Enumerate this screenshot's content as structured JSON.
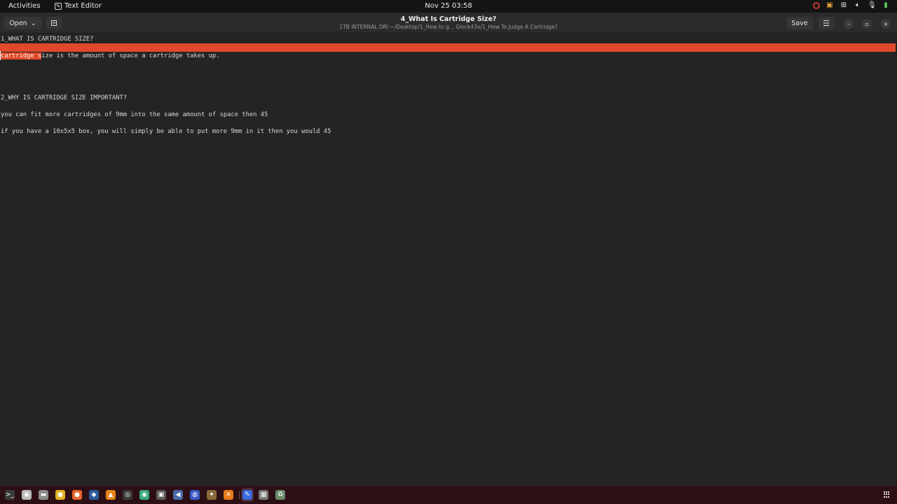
{
  "topbar": {
    "activities": "Activities",
    "app_name": "Text Editor",
    "clock": "Nov 25  03:58",
    "tray_icons": [
      "record-disc-icon",
      "screen-share-icon",
      "network-icon",
      "volume-icon",
      "microphone-icon",
      "battery-icon"
    ]
  },
  "headerbar": {
    "open_label": "Open",
    "open_chevron": "⌄",
    "new_tab_icon": "+",
    "title": "4_What Is Cartridge Size?",
    "subtitle": "1TB INTERNAL DRI ~/Desktop/1_How to g… Glock43x/1_How To Judge A Cartridge?",
    "save_label": "Save",
    "menu_icon": "☰",
    "minimize_icon": "–",
    "maximize_icon": "▫",
    "close_icon": "×"
  },
  "editor": {
    "lines": [
      "1_WHAT IS CARTRIDGE SIZE?",
      "",
      "cartridge size is the amount of space a cartridge takes up.",
      "",
      "",
      "2_WHY IS CARTRIDGE SIZE IMPORTANT?",
      "",
      "you can fit more cartridges of 9mm into the same amount of space then 45",
      "",
      "if you have a 10x5x5 box, you will simply be able to put more 9mm in it then you would 45"
    ],
    "line3_selected": "cartridge s",
    "line3_rest": "ize is the amount of space a cartridge takes up.",
    "highlight_color": "#e0492a"
  },
  "dock": {
    "apps": [
      {
        "name": "terminal",
        "glyph": ">_",
        "color": "#3a3a3a"
      },
      {
        "name": "screenshot",
        "glyph": "◉",
        "color": "#bdbdbd"
      },
      {
        "name": "files",
        "glyph": "▬",
        "color": "#8a8a8a"
      },
      {
        "name": "chrome",
        "glyph": "●",
        "color": "#e0b020"
      },
      {
        "name": "firefox",
        "glyph": "●",
        "color": "#e8632a"
      },
      {
        "name": "steam",
        "glyph": "◆",
        "color": "#2a5a9a"
      },
      {
        "name": "vlc",
        "glyph": "▲",
        "color": "#e8801a"
      },
      {
        "name": "obs",
        "glyph": "◎",
        "color": "#3a3a3a"
      },
      {
        "name": "app-green",
        "glyph": "◉",
        "color": "#3aa87a"
      },
      {
        "name": "app-gray",
        "glyph": "▣",
        "color": "#5a5a5a"
      },
      {
        "name": "app-blue",
        "glyph": "◀",
        "color": "#4a6aa8"
      },
      {
        "name": "app-circle",
        "glyph": "◍",
        "color": "#3a5ac8"
      },
      {
        "name": "app-game",
        "glyph": "✦",
        "color": "#8a6a3a"
      },
      {
        "name": "app-orange",
        "glyph": "✕",
        "color": "#e87a1a"
      },
      {
        "name": "text-editor",
        "glyph": "✎",
        "color": "#3a6ae0"
      },
      {
        "name": "app-gray2",
        "glyph": "▦",
        "color": "#7a7a7a"
      },
      {
        "name": "trash",
        "glyph": "♻",
        "color": "#6a8a6a"
      }
    ]
  }
}
